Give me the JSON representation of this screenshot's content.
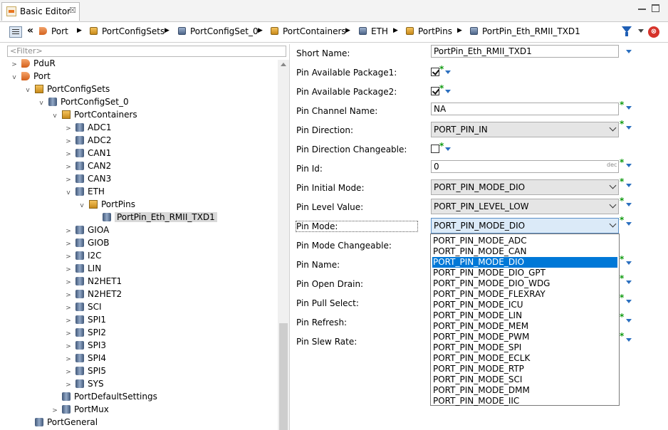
{
  "tab": {
    "title": "Basic Editor",
    "close": "☒"
  },
  "breadcrumb": {
    "back": "«",
    "items": [
      "Port",
      "PortConfigSets",
      "PortConfigSet_0",
      "PortContainers",
      "ETH",
      "PortPins",
      "PortPin_Eth_RMII_TXD1"
    ],
    "separator": "▶"
  },
  "tree": {
    "filter_placeholder": "<Filter>",
    "rows": [
      "PduR",
      "Port",
      "PortConfigSets",
      "PortConfigSet_0",
      "PortContainers",
      "ADC1",
      "ADC2",
      "CAN1",
      "CAN2",
      "CAN3",
      "ETH",
      "PortPins",
      "PortPin_Eth_RMII_TXD1",
      "GIOA",
      "GIOB",
      "I2C",
      "LIN",
      "N2HET1",
      "N2HET2",
      "SCI",
      "SPI1",
      "SPI2",
      "SPI3",
      "SPI4",
      "SPI5",
      "SYS",
      "PortDefaultSettings",
      "PortMux",
      "PortGeneral"
    ],
    "selected": "PortPin_Eth_RMII_TXD1"
  },
  "properties": {
    "short_name": {
      "label": "Short Name:",
      "value": "PortPin_Eth_RMII_TXD1"
    },
    "pin_available_package1": {
      "label": "Pin Available Package1:",
      "checked": true
    },
    "pin_available_package2": {
      "label": "Pin Available Package2:",
      "checked": true
    },
    "pin_channel_name": {
      "label": "Pin Channel Name:",
      "value": "NA"
    },
    "pin_direction": {
      "label": "Pin Direction:",
      "value": "PORT_PIN_IN"
    },
    "pin_direction_changeable": {
      "label": "Pin Direction Changeable:",
      "checked": false
    },
    "pin_id": {
      "label": "Pin Id:",
      "value": "0",
      "unit": "dec"
    },
    "pin_initial_mode": {
      "label": "Pin Initial Mode:",
      "value": "PORT_PIN_MODE_DIO"
    },
    "pin_level_value": {
      "label": "Pin Level Value:",
      "value": "PORT_PIN_LEVEL_LOW"
    },
    "pin_mode": {
      "label": "Pin Mode:",
      "value": "PORT_PIN_MODE_DIO"
    },
    "pin_mode_changeable": {
      "label": "Pin Mode Changeable:"
    },
    "pin_name": {
      "label": "Pin Name:"
    },
    "pin_open_drain": {
      "label": "Pin Open Drain:"
    },
    "pin_pull_select": {
      "label": "Pin Pull Select:"
    },
    "pin_refresh": {
      "label": "Pin Refresh:"
    },
    "pin_slew_rate": {
      "label": "Pin Slew Rate:"
    }
  },
  "required_marker": "*",
  "pin_mode_options": [
    "PORT_PIN_MODE_ADC",
    "PORT_PIN_MODE_CAN",
    "PORT_PIN_MODE_DIO",
    "PORT_PIN_MODE_DIO_GPT",
    "PORT_PIN_MODE_DIO_WDG",
    "PORT_PIN_MODE_FLEXRAY",
    "PORT_PIN_MODE_ICU",
    "PORT_PIN_MODE_LIN",
    "PORT_PIN_MODE_MEM",
    "PORT_PIN_MODE_PWM",
    "PORT_PIN_MODE_SPI",
    "PORT_PIN_MODE_ECLK",
    "PORT_PIN_MODE_RTP",
    "PORT_PIN_MODE_SCI",
    "PORT_PIN_MODE_DMM",
    "PORT_PIN_MODE_IIC"
  ],
  "pin_mode_highlighted_index": 2,
  "colors": {
    "highlight": "#0078d7",
    "required": "#0f9a0f",
    "dropdown_arrow": "#2b6fbf"
  }
}
